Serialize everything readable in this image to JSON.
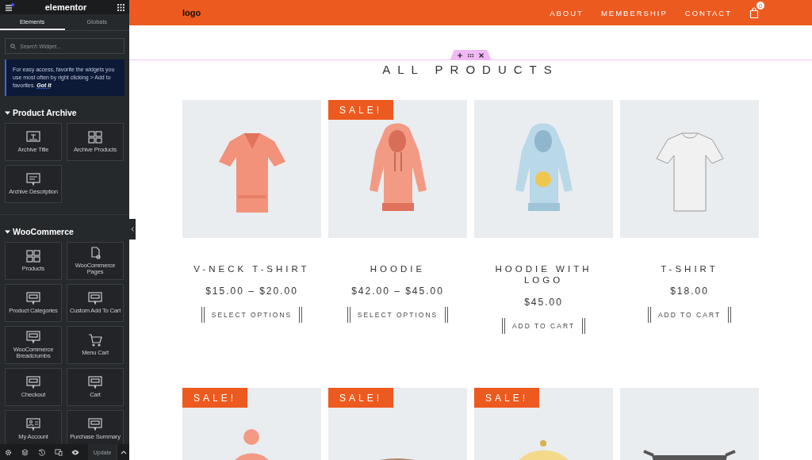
{
  "editor": {
    "title": "elementor",
    "tabs": [
      {
        "label": "Elements",
        "selected": true
      },
      {
        "label": "Globals",
        "selected": false
      }
    ],
    "search": {
      "placeholder": "Search Widget..."
    },
    "notice": {
      "text": "For easy access, favorite the widgets you use most often by right clicking > Add to favorites.",
      "link": "Got It"
    },
    "sections": [
      {
        "title": "Product Archive",
        "expanded": true,
        "widgets": [
          {
            "label": "Archive Title",
            "kind": "title"
          },
          {
            "label": "Archive Products",
            "kind": "grid"
          },
          {
            "label": "Archive Description",
            "kind": "text"
          }
        ]
      },
      {
        "title": "WooCommerce",
        "expanded": true,
        "widgets": [
          {
            "label": "Products",
            "kind": "grid"
          },
          {
            "label": "WooCommerce Pages",
            "kind": "page"
          },
          {
            "label": "Product Categories",
            "kind": "screen"
          },
          {
            "label": "Custom Add To Cart",
            "kind": "screen"
          },
          {
            "label": "WooCommerce Breadcrumbs",
            "kind": "screen"
          },
          {
            "label": "Menu Cart",
            "kind": "cart"
          },
          {
            "label": "Checkout",
            "kind": "screen"
          },
          {
            "label": "Cart",
            "kind": "screen"
          },
          {
            "label": "My Account",
            "kind": "account"
          },
          {
            "label": "Purchase Summary",
            "kind": "screen"
          }
        ]
      }
    ],
    "footer": {
      "update": "Update"
    }
  },
  "site": {
    "logo": "logo",
    "nav": [
      "ABOUT",
      "MEMBERSHIP",
      "CONTACT"
    ],
    "cart_count": "0",
    "heading": "ALL PRODUCTS",
    "product_rows": [
      [
        {
          "name": "V-NECK T-SHIRT",
          "price": "$15.00 – $20.00",
          "button": "SELECT OPTIONS"
        },
        {
          "name": "HOODIE",
          "price": "$42.00 – $45.00",
          "button": "SELECT OPTIONS",
          "badge": "SALE!"
        },
        {
          "name": "HOODIE WITH LOGO",
          "price": "$45.00",
          "button": "ADD TO CART"
        },
        {
          "name": "T-SHIRT",
          "price": "$18.00",
          "button": "ADD TO CART"
        }
      ],
      [
        {
          "badge": "SALE!",
          "kind": "picture"
        },
        {
          "badge": "SALE!",
          "kind": "picture"
        },
        {
          "badge": "SALE!",
          "kind": "picture"
        },
        {
          "kind": "picture"
        }
      ]
    ]
  }
}
